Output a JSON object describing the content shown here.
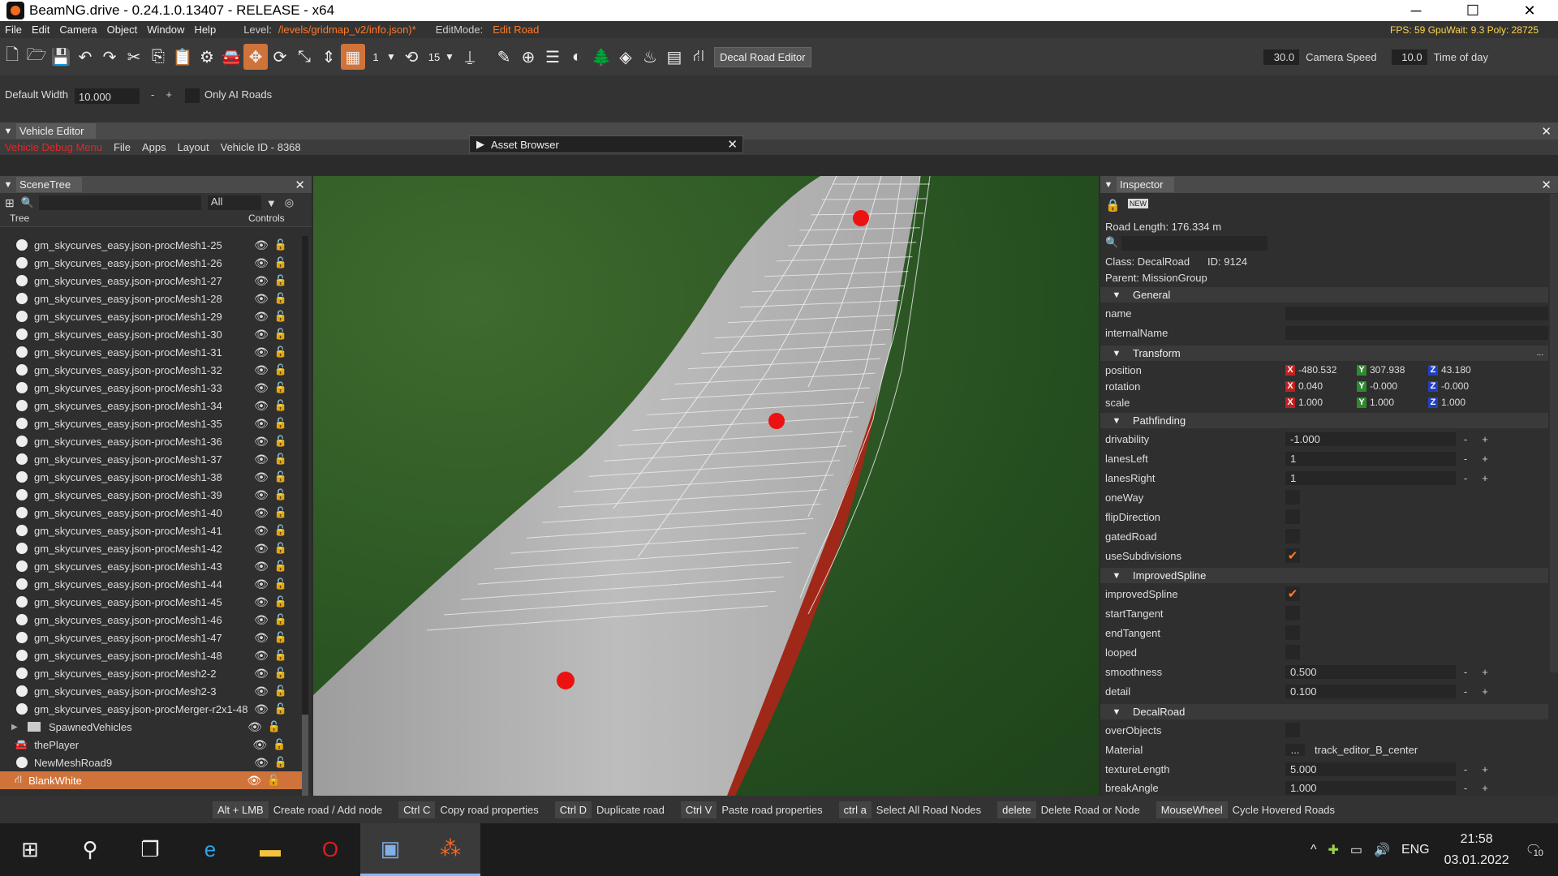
{
  "window": {
    "title": "BeamNG.drive - 0.24.1.0.13407 - RELEASE - x64",
    "minimize": "─",
    "maximize": "☐",
    "close": "✕"
  },
  "menu": {
    "items": [
      "File",
      "Edit",
      "Camera",
      "Object",
      "Window",
      "Help"
    ],
    "level_label": "Level:",
    "level_value": "/levels/gridmap_v2/info.json)*",
    "editmode_label": "EditMode:",
    "editmode_value": "Edit Road",
    "stats": "FPS: 59  GpuWait: 9.3  Poly: 28725"
  },
  "toolbar": {
    "snap_value": "1",
    "rot_value": "15",
    "tooltip": "Decal Road Editor",
    "cam_value": "30.0",
    "camera_speed_label": "Camera Speed",
    "time_value": "10.0",
    "time_label": "Time of day"
  },
  "road_props": {
    "default_width_label": "Default Width",
    "default_width_value": "10.000",
    "minus": "-",
    "plus": "+",
    "only_ai_label": "Only AI Roads"
  },
  "vehicle_editor": {
    "title": "Vehicle Editor",
    "debug_menu": "Vehicle Debug Menu",
    "menus": [
      "File",
      "Apps",
      "Layout"
    ],
    "vehicle_id": "Vehicle ID - 8368"
  },
  "asset_browser": {
    "title": "Asset Browser"
  },
  "scenetree": {
    "title": "SceneTree",
    "filter": "All",
    "col_tree": "Tree",
    "col_controls": "Controls",
    "items": [
      {
        "name": "gm_skycurves_easy.json-procMesh1-25"
      },
      {
        "name": "gm_skycurves_easy.json-procMesh1-26"
      },
      {
        "name": "gm_skycurves_easy.json-procMesh1-27"
      },
      {
        "name": "gm_skycurves_easy.json-procMesh1-28"
      },
      {
        "name": "gm_skycurves_easy.json-procMesh1-29"
      },
      {
        "name": "gm_skycurves_easy.json-procMesh1-30"
      },
      {
        "name": "gm_skycurves_easy.json-procMesh1-31"
      },
      {
        "name": "gm_skycurves_easy.json-procMesh1-32"
      },
      {
        "name": "gm_skycurves_easy.json-procMesh1-33"
      },
      {
        "name": "gm_skycurves_easy.json-procMesh1-34"
      },
      {
        "name": "gm_skycurves_easy.json-procMesh1-35"
      },
      {
        "name": "gm_skycurves_easy.json-procMesh1-36"
      },
      {
        "name": "gm_skycurves_easy.json-procMesh1-37"
      },
      {
        "name": "gm_skycurves_easy.json-procMesh1-38"
      },
      {
        "name": "gm_skycurves_easy.json-procMesh1-39"
      },
      {
        "name": "gm_skycurves_easy.json-procMesh1-40"
      },
      {
        "name": "gm_skycurves_easy.json-procMesh1-41"
      },
      {
        "name": "gm_skycurves_easy.json-procMesh1-42"
      },
      {
        "name": "gm_skycurves_easy.json-procMesh1-43"
      },
      {
        "name": "gm_skycurves_easy.json-procMesh1-44"
      },
      {
        "name": "gm_skycurves_easy.json-procMesh1-45"
      },
      {
        "name": "gm_skycurves_easy.json-procMesh1-46"
      },
      {
        "name": "gm_skycurves_easy.json-procMesh1-47"
      },
      {
        "name": "gm_skycurves_easy.json-procMesh1-48"
      },
      {
        "name": "gm_skycurves_easy.json-procMesh2-2"
      },
      {
        "name": "gm_skycurves_easy.json-procMesh2-3"
      },
      {
        "name": "gm_skycurves_easy.json-procMerger-r2x1-48"
      }
    ],
    "folder": "SpawnedVehicles",
    "player": "thePlayer",
    "meshroad": "NewMeshRoad9",
    "selected": "BlankWhite"
  },
  "inspector": {
    "title": "Inspector",
    "road_length": "Road Length: 176.334 m",
    "class": "Class:  DecalRoad",
    "id": "ID:  9124",
    "parent": "Parent:  MissionGroup",
    "sections": {
      "general": "General",
      "transform": "Transform",
      "pathfinding": "Pathfinding",
      "spline": "ImprovedSpline",
      "decal": "DecalRoad"
    },
    "name_label": "name",
    "internal_label": "internalName",
    "position_label": "position",
    "position": {
      "x": "-480.532",
      "y": "307.938",
      "z": "43.180"
    },
    "rotation_label": "rotation",
    "rotation": {
      "x": "0.040",
      "y": "-0.000",
      "z": "-0.000"
    },
    "scale_label": "scale",
    "scale": {
      "x": "1.000",
      "y": "1.000",
      "z": "1.000"
    },
    "drivability_label": "drivability",
    "drivability": "-1.000",
    "lanesleft_label": "lanesLeft",
    "lanesleft": "1",
    "lanesright_label": "lanesRight",
    "lanesright": "1",
    "oneway_label": "oneWay",
    "flip_label": "flipDirection",
    "gated_label": "gatedRoad",
    "usesub_label": "useSubdivisions",
    "improved_label": "improvedSpline",
    "start_label": "startTangent",
    "end_label": "endTangent",
    "looped_label": "looped",
    "smooth_label": "smoothness",
    "smooth": "0.500",
    "detail_label": "detail",
    "detail": "0.100",
    "overobj_label": "overObjects",
    "material_label": "Material",
    "material": "track_editor_B_center",
    "material_btn": "...",
    "texlen_label": "textureLength",
    "texlen": "5.000",
    "break_label": "breakAngle",
    "break": "1.000",
    "axis_x": "X",
    "axis_y": "Y",
    "axis_z": "Z",
    "check": "✔",
    "ellipsis": "..."
  },
  "hints": [
    {
      "key": "Alt + LMB",
      "desc": "Create road / Add node"
    },
    {
      "key": "Ctrl C",
      "desc": "Copy road properties"
    },
    {
      "key": "Ctrl D",
      "desc": "Duplicate road"
    },
    {
      "key": "Ctrl V",
      "desc": "Paste road properties"
    },
    {
      "key": "ctrl a",
      "desc": "Select All Road Nodes"
    },
    {
      "key": "delete",
      "desc": "Delete Road or Node"
    },
    {
      "key": "MouseWheel",
      "desc": "Cycle Hovered Roads"
    }
  ],
  "taskbar": {
    "lang": "ENG",
    "time": "21:58",
    "date": "03.01.2022",
    "notif": "10"
  },
  "colors": {
    "accent": "#d0733a",
    "orange_text": "#ff7a2a",
    "road_edge": "#b02a1a",
    "node": "#ee1111"
  }
}
